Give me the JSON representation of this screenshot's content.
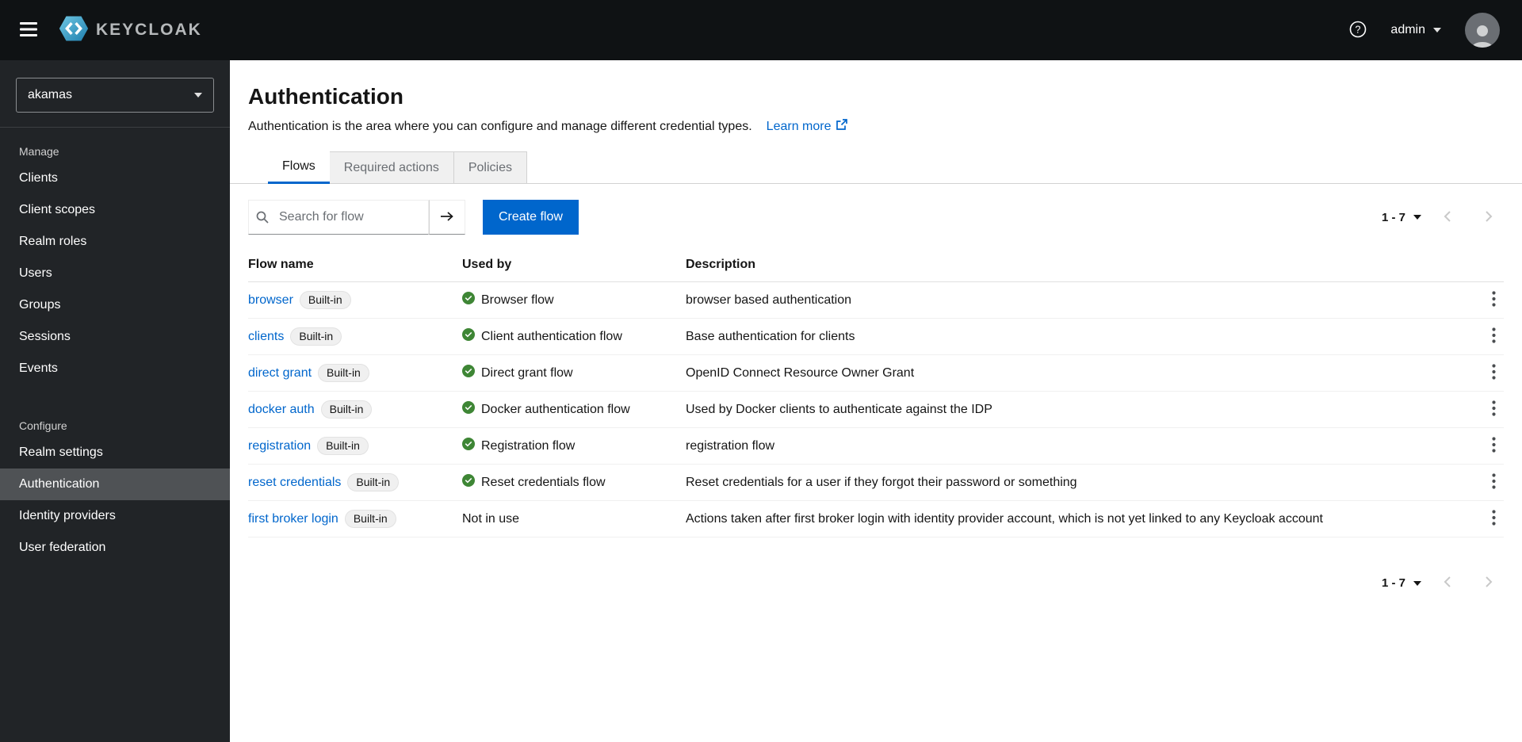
{
  "colors": {
    "accent": "#0066cc",
    "success_green": "#3e8635",
    "header_bg": "#0f1214",
    "sidebar_bg": "#212427",
    "active_nav_bg": "#4f5255"
  },
  "header": {
    "brand_text": "KEYCLOAK",
    "username": "admin"
  },
  "sidebar": {
    "realm_selector": {
      "value": "akamas"
    },
    "sections": [
      {
        "label": "Manage",
        "items": [
          {
            "label": "Clients"
          },
          {
            "label": "Client scopes"
          },
          {
            "label": "Realm roles"
          },
          {
            "label": "Users"
          },
          {
            "label": "Groups"
          },
          {
            "label": "Sessions"
          },
          {
            "label": "Events"
          }
        ]
      },
      {
        "label": "Configure",
        "items": [
          {
            "label": "Realm settings"
          },
          {
            "label": "Authentication",
            "active": true
          },
          {
            "label": "Identity providers"
          },
          {
            "label": "User federation"
          }
        ]
      }
    ]
  },
  "main": {
    "title": "Authentication",
    "description": "Authentication is the area where you can configure and manage different credential types.",
    "learn_more_label": "Learn more",
    "tabs": [
      {
        "label": "Flows",
        "active": true
      },
      {
        "label": "Required actions"
      },
      {
        "label": "Policies"
      }
    ],
    "toolbar": {
      "search_placeholder": "Search for flow",
      "create_button_label": "Create flow",
      "pagination_label": "1 - 7"
    },
    "table": {
      "headers": {
        "flow_name": "Flow name",
        "used_by": "Used by",
        "description": "Description"
      },
      "rows": [
        {
          "name": "browser",
          "badge": "Built-in",
          "in_use": true,
          "used_by": "Browser flow",
          "description": "browser based authentication"
        },
        {
          "name": "clients",
          "badge": "Built-in",
          "in_use": true,
          "used_by": "Client authentication flow",
          "description": "Base authentication for clients"
        },
        {
          "name": "direct grant",
          "badge": "Built-in",
          "in_use": true,
          "used_by": "Direct grant flow",
          "description": "OpenID Connect Resource Owner Grant"
        },
        {
          "name": "docker auth",
          "badge": "Built-in",
          "in_use": true,
          "used_by": "Docker authentication flow",
          "description": "Used by Docker clients to authenticate against the IDP"
        },
        {
          "name": "registration",
          "badge": "Built-in",
          "in_use": true,
          "used_by": "Registration flow",
          "description": "registration flow"
        },
        {
          "name": "reset credentials",
          "badge": "Built-in",
          "in_use": true,
          "used_by": "Reset credentials flow",
          "description": "Reset credentials for a user if they forgot their password or something"
        },
        {
          "name": "first broker login",
          "badge": "Built-in",
          "in_use": false,
          "used_by": "Not in use",
          "description": "Actions taken after first broker login with identity provider account, which is not yet linked to any Keycloak account"
        }
      ]
    },
    "footer_pagination_label": "1 - 7"
  }
}
